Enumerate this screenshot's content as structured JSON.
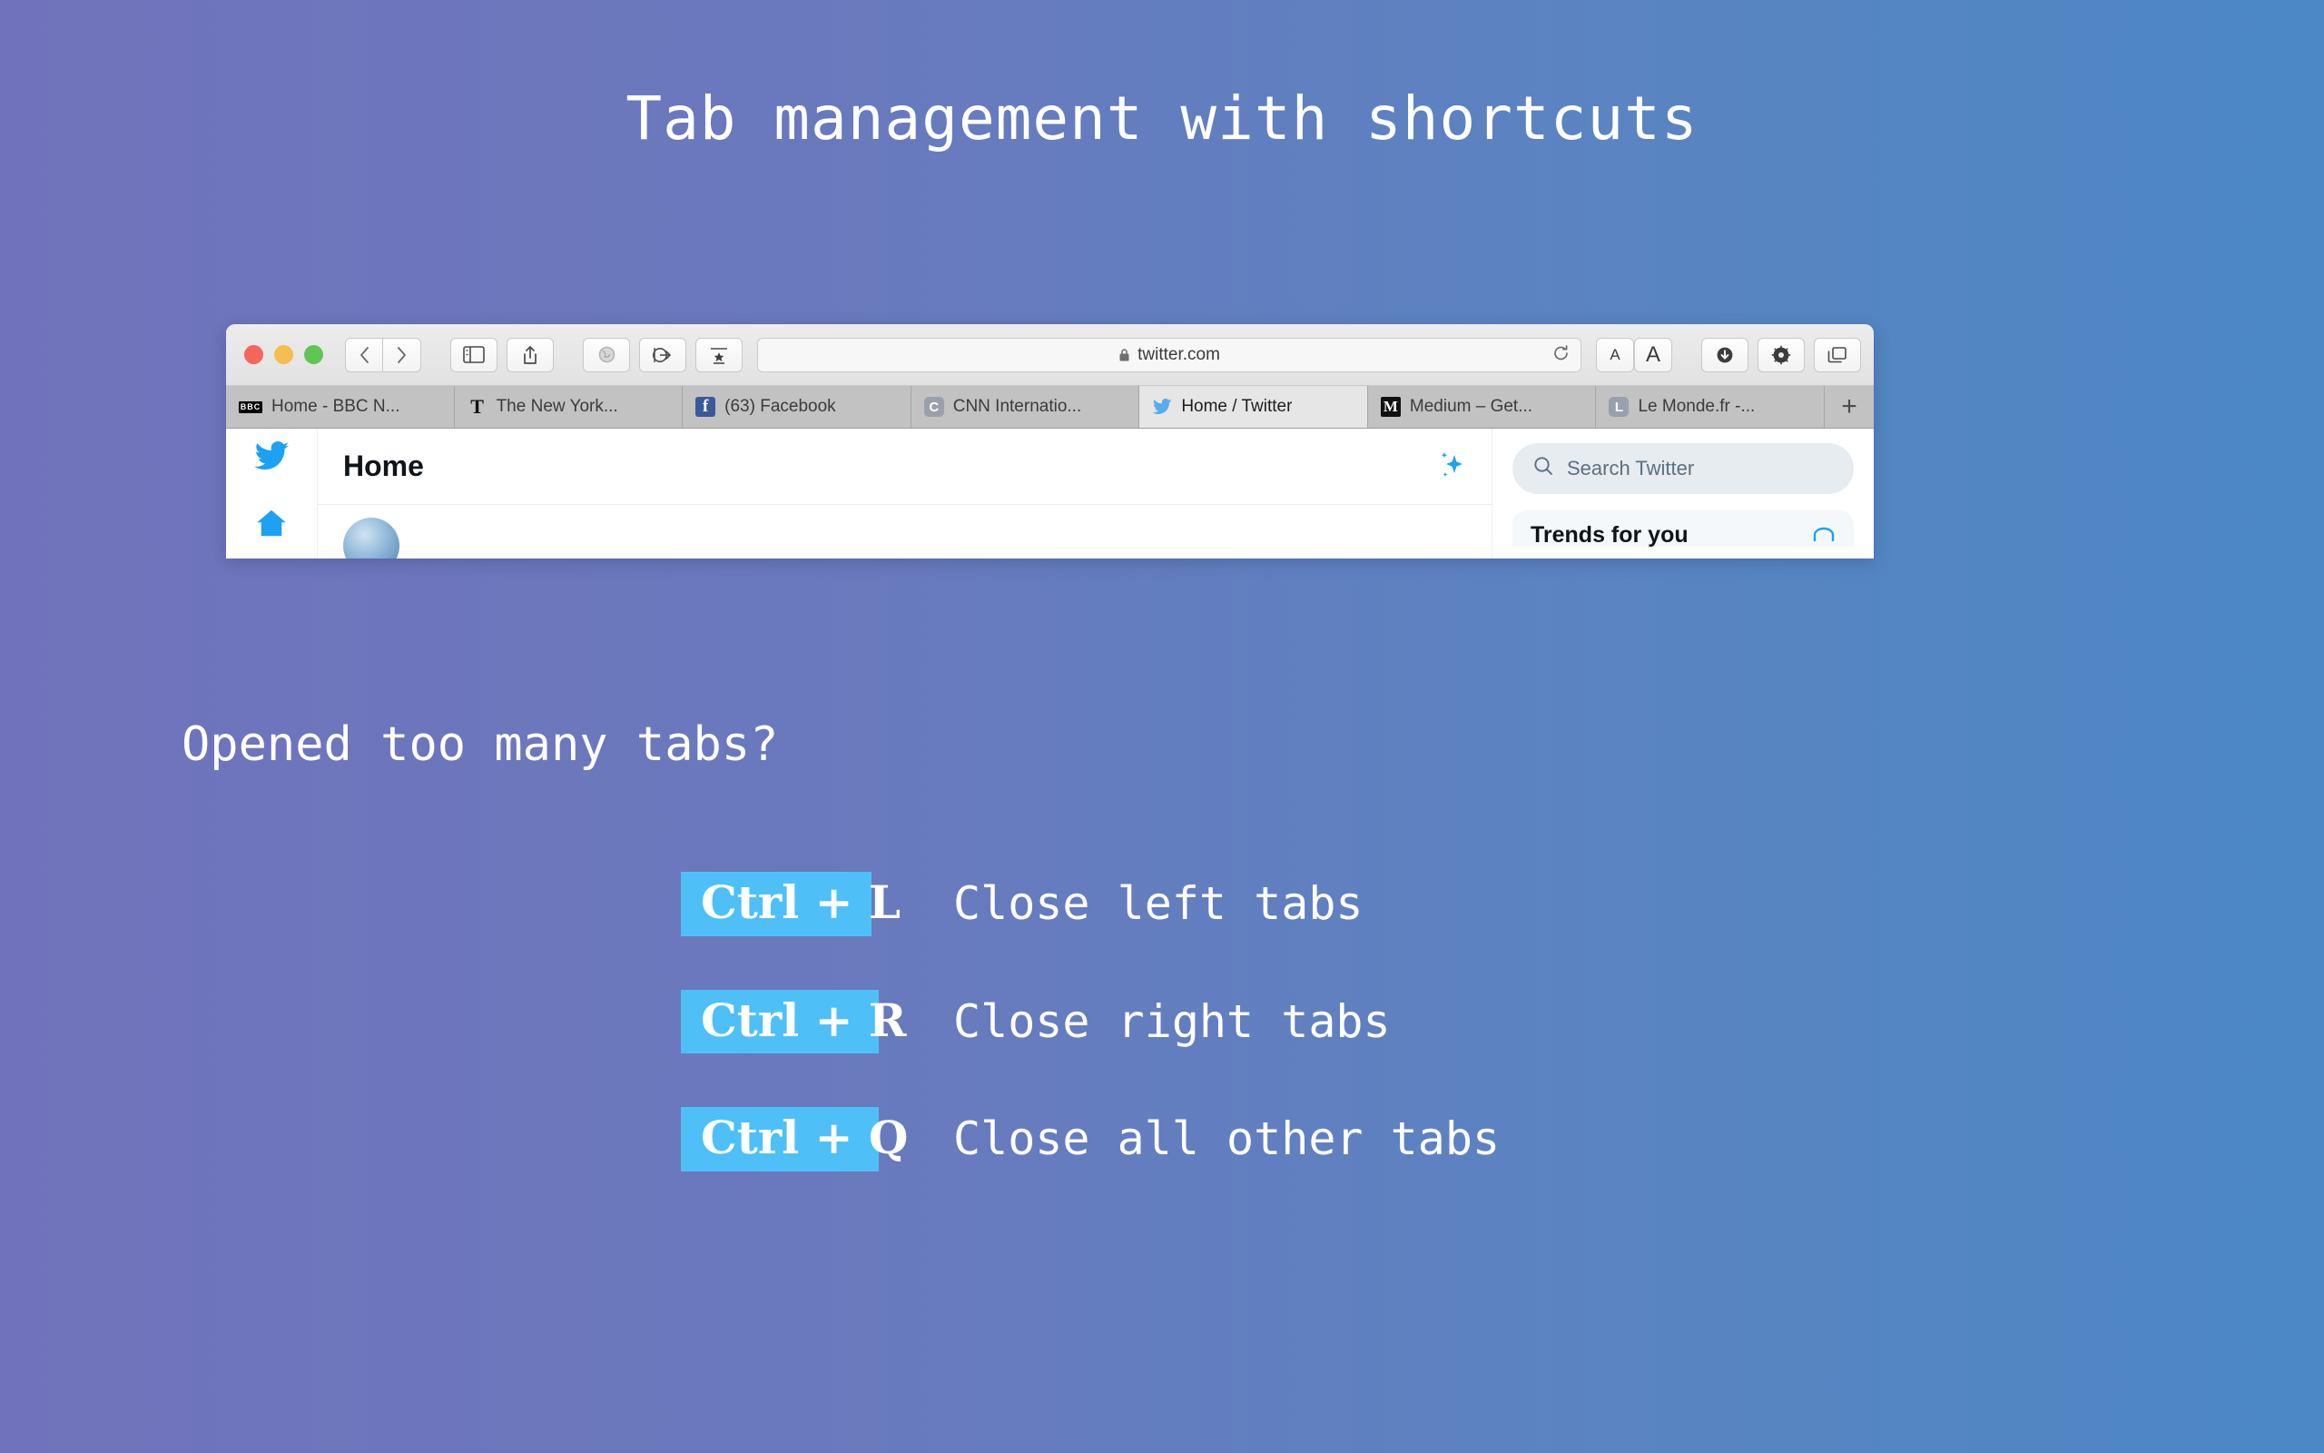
{
  "slide": {
    "title": "Tab management with shortcuts",
    "question": "Opened too many tabs?",
    "background": {
      "gradient_from": "#7073bb",
      "gradient_to": "#4b88c4",
      "direction": "left-to-right"
    },
    "accent_highlight": "#4fc0f7"
  },
  "browser": {
    "toolbar": {
      "traffic_lights": [
        "close",
        "minimize",
        "zoom"
      ],
      "back_label": "‹",
      "forward_label": "›",
      "sidebar_icon": "sidebar-icon",
      "share_icon": "share-icon",
      "web_icon": "globe-icon",
      "airdrop_icon": "airdrop-icon",
      "reader_icon": "reader-icon",
      "url": "twitter.com",
      "lock_icon": "lock-icon",
      "reload_icon": "reload-icon",
      "text_small_label": "A",
      "text_large_label": "A",
      "downloads_icon": "downloads-icon",
      "settings_icon": "gear-icon",
      "tab_overview_icon": "tab-overview-icon"
    },
    "tabs": [
      {
        "title": "Home - BBC N...",
        "favicon": "bbc-icon",
        "favicon_text": "BBC",
        "active": false
      },
      {
        "title": "The New York...",
        "favicon": "nyt-icon",
        "favicon_text": "T",
        "active": false
      },
      {
        "title": "(63) Facebook",
        "favicon": "facebook-icon",
        "favicon_text": "f",
        "active": false
      },
      {
        "title": "CNN Internatio...",
        "favicon": "cnn-icon",
        "favicon_text": "C",
        "active": false
      },
      {
        "title": "Home / Twitter",
        "favicon": "twitter-icon",
        "favicon_text": "",
        "active": true
      },
      {
        "title": "Medium – Get...",
        "favicon": "medium-icon",
        "favicon_text": "M",
        "active": false
      },
      {
        "title": "Le Monde.fr -...",
        "favicon": "lemonde-icon",
        "favicon_text": "L",
        "active": false
      }
    ],
    "new_tab_label": "+",
    "page": {
      "logo_icon": "twitter-bird-icon",
      "home_nav_icon": "home-icon",
      "header_title": "Home",
      "sparkle_icon": "sparkles-icon",
      "search_placeholder": "Search Twitter",
      "search_icon": "search-icon",
      "card_title": "Trends for you",
      "card_settings_icon": "card-settings-icon"
    }
  },
  "shortcuts": [
    {
      "keys": "Ctrl + L",
      "description": "Close left tabs"
    },
    {
      "keys": "Ctrl + R",
      "description": "Close right tabs"
    },
    {
      "keys": "Ctrl + Q",
      "description": "Close all other tabs"
    }
  ]
}
